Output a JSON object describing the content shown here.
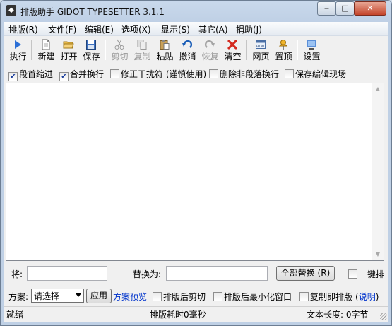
{
  "window": {
    "title": "排版助手 GIDOT TYPESETTER 3.1.1",
    "app_icon": "diamond-app-icon",
    "caption": {
      "minimize": "‒",
      "maximize": "□",
      "close": "✕"
    }
  },
  "menu": [
    {
      "label": "排版(R)"
    },
    {
      "label": "文件(F)"
    },
    {
      "label": "编辑(E)"
    },
    {
      "label": "选项(X)"
    },
    {
      "label": "显示(S)"
    },
    {
      "label": "其它(A)"
    },
    {
      "label": "捐助(J)"
    }
  ],
  "toolbar": {
    "execute": "执行",
    "new": "新建",
    "open": "打开",
    "save": "保存",
    "cut": "剪切",
    "copy": "复制",
    "paste": "粘贴",
    "undo": "撤消",
    "redo": "恢复",
    "clear": "清空",
    "webpage": "网页",
    "pin_top": "置顶",
    "settings": "设置",
    "webpage_icon_text": "HTML"
  },
  "options": {
    "indent": {
      "label": "段首缩进",
      "checked": true
    },
    "merge": {
      "label": "合并换行",
      "checked": true
    },
    "fix_interference": {
      "label": "修正干扰符 (谨慎使用)",
      "checked": false
    },
    "remove_non_para_breaks": {
      "label": "删除非段落换行",
      "checked": false
    },
    "save_edit_state": {
      "label": "保存编辑现场",
      "checked": false
    }
  },
  "editor": {
    "content": ""
  },
  "replace": {
    "find_label": "将:",
    "find_value": "",
    "replace_label": "替换为:",
    "replace_value": "",
    "replace_all_button": "全部替换 (R)",
    "one_click_label": "一键排"
  },
  "scheme": {
    "label": "方案:",
    "selected": "请选择",
    "apply_button": "应用",
    "preview_link": "方案预览",
    "cut_after": "排版后剪切",
    "minimize_after": "排版后最小化窗口",
    "copy_then_format": "复制即排版",
    "explain_link": "说明",
    "paren_open": "(",
    "paren_close": ")"
  },
  "status": {
    "ready": "就绪",
    "elapsed": "排版耗时0毫秒",
    "length": "文本长度: 0字节"
  }
}
